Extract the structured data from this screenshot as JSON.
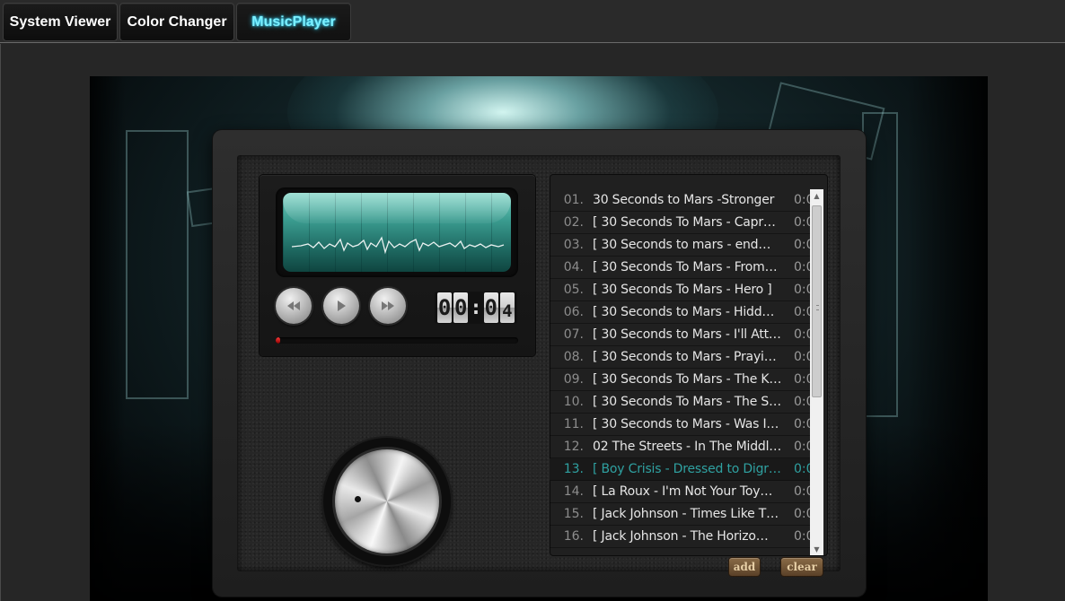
{
  "tabs": [
    {
      "label": "System Viewer"
    },
    {
      "label": "Color Changer"
    },
    {
      "label": "MusicPlayer"
    }
  ],
  "player": {
    "timer": {
      "d1": "0",
      "d2": "0",
      "colon": ":",
      "d3": "0",
      "d4": "4"
    },
    "progress_fraction": 0.02,
    "controls": {
      "prev_icon": "rewind-icon",
      "play_icon": "play-icon",
      "next_icon": "fast-forward-icon"
    }
  },
  "playlist": [
    {
      "num": "01.",
      "title": "30 Seconds to Mars -Stronger",
      "time": "0:0"
    },
    {
      "num": "02.",
      "title": "[ 30 Seconds To Mars - Capr…",
      "time": "0:0"
    },
    {
      "num": "03.",
      "title": "[ 30 Seconds to mars - end…",
      "time": "0:0"
    },
    {
      "num": "04.",
      "title": "[ 30 Seconds To Mars - From…",
      "time": "0:0"
    },
    {
      "num": "05.",
      "title": "[ 30 Seconds To Mars - Hero ]",
      "time": "0:0"
    },
    {
      "num": "06.",
      "title": "[ 30 Seconds to Mars - Hidd…",
      "time": "0:0"
    },
    {
      "num": "07.",
      "title": "[ 30 Seconds to Mars - I'll Att…",
      "time": "0:0"
    },
    {
      "num": "08.",
      "title": "[ 30 Seconds to Mars - Prayi…",
      "time": "0:0"
    },
    {
      "num": "09.",
      "title": "[ 30 Seconds To Mars - The K…",
      "time": "0:0"
    },
    {
      "num": "10.",
      "title": "[ 30 Seconds To Mars - The S…",
      "time": "0:0"
    },
    {
      "num": "11.",
      "title": "[ 30 Seconds to Mars - Was I…",
      "time": "0:0"
    },
    {
      "num": "12.",
      "title": "02 The Streets - In The Middl…",
      "time": "0:0"
    },
    {
      "num": "13.",
      "title": "[ Boy Crisis - Dressed to Digr…",
      "time": "0:0",
      "current": true
    },
    {
      "num": "14.",
      "title": "[ La Roux - I'm Not Your Toy…",
      "time": "0:0"
    },
    {
      "num": "15.",
      "title": "[ Jack Johnson - Times Like T…",
      "time": "0:0"
    },
    {
      "num": "16.",
      "title": "[ Jack Johnson - The Horizo…",
      "time": "0:0"
    }
  ],
  "buttons": {
    "add": "add",
    "clear": "clear"
  },
  "colors": {
    "accent_cyan": "#7cf0ff",
    "current_track": "#2fa1a1",
    "lcd": "#3a9b8f",
    "progress": "#ff3a3a"
  }
}
